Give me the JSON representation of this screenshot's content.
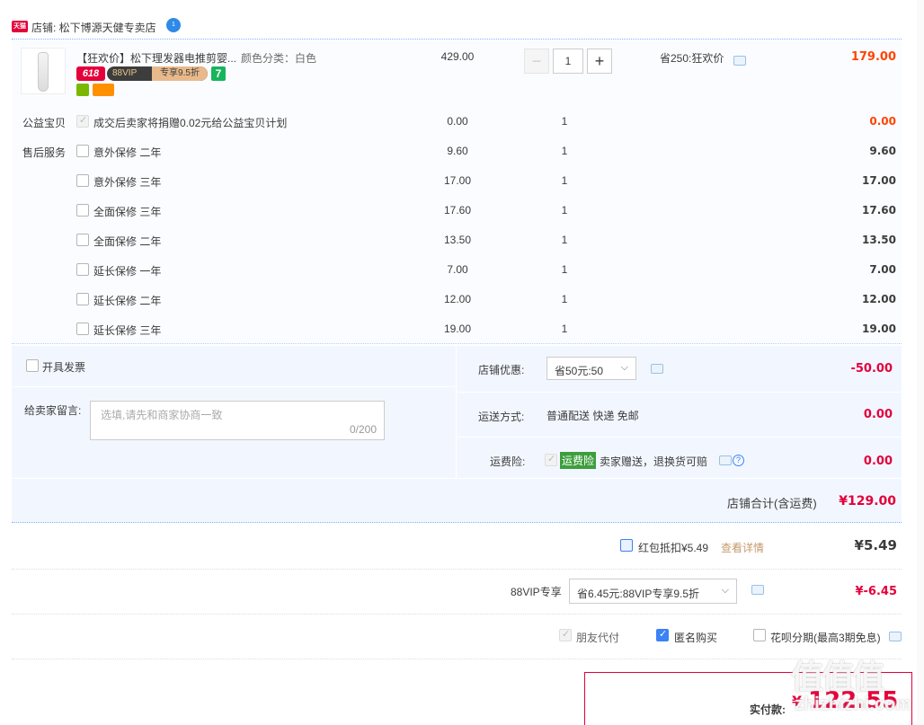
{
  "shop": {
    "logo_text": "天猫",
    "name": "店铺: 松下博源天健专卖店",
    "wang_text": "1"
  },
  "item": {
    "title": "【狂欢价】松下理发器电推剪婴...",
    "sku": "颜色分类：白色",
    "price": "429.00",
    "quantity": "1",
    "minus": "−",
    "plus": "+",
    "promo": "省250:狂欢价",
    "subtotal": "179.00",
    "tag_618": "618",
    "vip_badge_left": "88VIP",
    "vip_badge_right": "专享9.5折",
    "tag_7": "7"
  },
  "charity": {
    "label": "公益宝贝",
    "text": "成交后卖家将捐赠0.02元给公益宝贝计划",
    "price": "0.00",
    "qty": "1",
    "sum": "0.00"
  },
  "after_sale": {
    "label": "售后服务",
    "items": [
      {
        "name": "意外保修 二年",
        "price": "9.60",
        "qty": "1",
        "sum": "9.60"
      },
      {
        "name": "意外保修 三年",
        "price": "17.00",
        "qty": "1",
        "sum": "17.00"
      },
      {
        "name": "全面保修 三年",
        "price": "17.60",
        "qty": "1",
        "sum": "17.60"
      },
      {
        "name": "全面保修 二年",
        "price": "13.50",
        "qty": "1",
        "sum": "13.50"
      },
      {
        "name": "延长保修 一年",
        "price": "7.00",
        "qty": "1",
        "sum": "7.00"
      },
      {
        "name": "延长保修 二年",
        "price": "12.00",
        "qty": "1",
        "sum": "12.00"
      },
      {
        "name": "延长保修 三年",
        "price": "19.00",
        "qty": "1",
        "sum": "19.00"
      }
    ]
  },
  "invoice": {
    "label": "开具发票"
  },
  "message": {
    "label": "给卖家留言:",
    "placeholder": "选填,请先和商家协商一致",
    "count": "0/200"
  },
  "shop_discount": {
    "label": "店铺优惠:",
    "value": "省50元:50",
    "chevron": "⌵",
    "amount": "-50.00"
  },
  "shipping": {
    "label": "运送方式:",
    "value": "普通配送 快递 免邮",
    "amount": "0.00"
  },
  "insurance": {
    "label": "运费险:",
    "tag": "运费险",
    "text": "卖家赠送，退换货可赔",
    "help": "?",
    "amount": "0.00"
  },
  "shop_total": {
    "label": "店铺合计(含运费)",
    "amount": "¥129.00"
  },
  "red_packet": {
    "label": "红包抵扣¥5.49",
    "link": "查看详情",
    "amount": "¥5.49"
  },
  "vip": {
    "label": "88VIP专享",
    "value": "省6.45元:88VIP专享9.5折",
    "chevron": "⌵",
    "amount": "¥-6.45"
  },
  "options": {
    "friend_pay": "朋友代付",
    "anonymous": "匿名购买",
    "huabei": "花呗分期(最高3期免息)"
  },
  "pay": {
    "label": "实付款:",
    "currency": "¥",
    "amount": "122.55"
  },
  "watermark": {
    "main": "值值值",
    "sub": "zhizhizhi.com"
  },
  "colors": {
    "accent": "#e4003a",
    "blue": "#3b82f6",
    "row_bg": "#fbfcff",
    "panel_bg": "#f2f7ff"
  }
}
